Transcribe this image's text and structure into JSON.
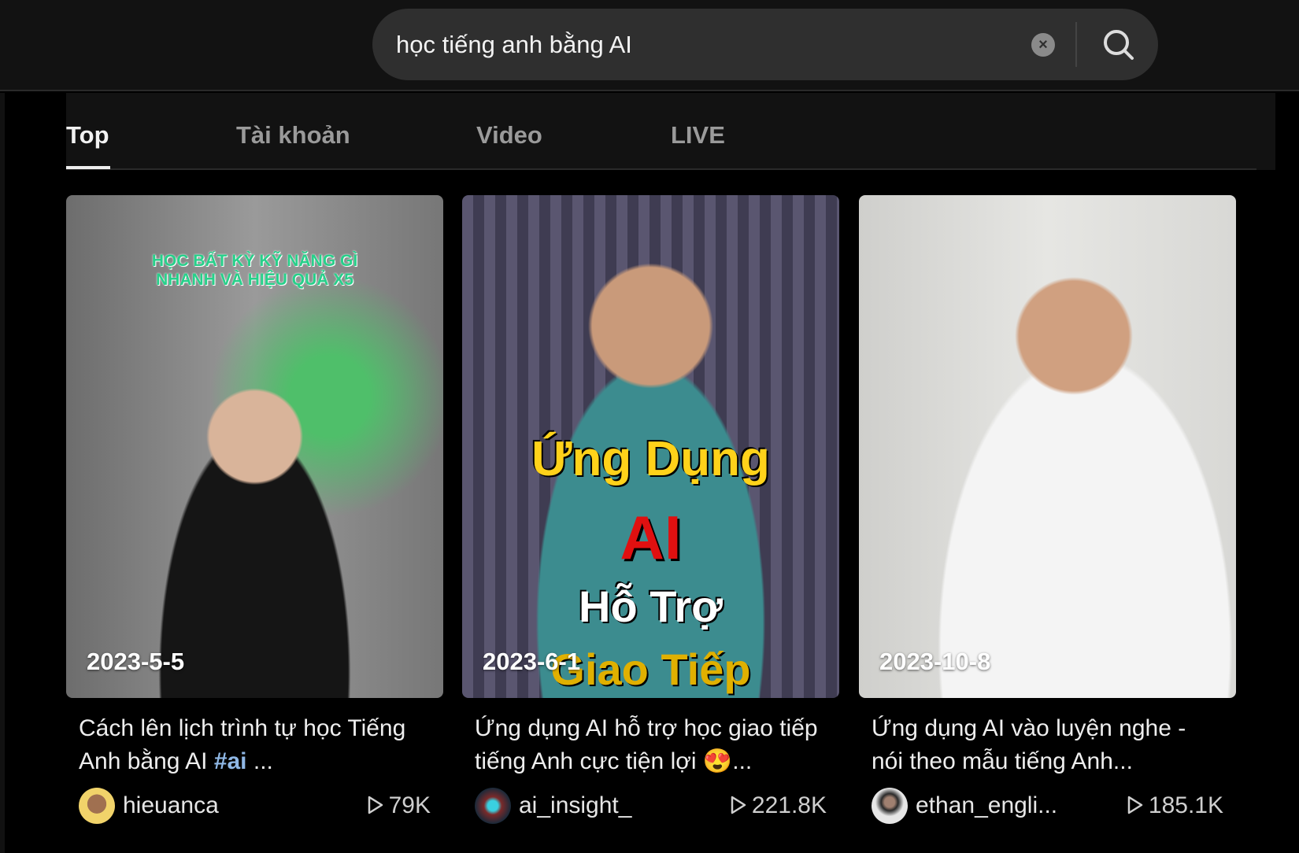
{
  "search": {
    "value": "học tiếng anh bằng AI",
    "clear_icon": "close-circle-icon",
    "search_icon": "search-icon"
  },
  "tabs": [
    {
      "label": "Top",
      "active": true
    },
    {
      "label": "Tài khoản"
    },
    {
      "label": "Video"
    },
    {
      "label": "LIVE"
    }
  ],
  "videos": [
    {
      "date": "2023-5-5",
      "overlay": [
        "HỌC BẤT KỲ KỸ NĂNG GÌ",
        "NHANH VÀ HIỆU QUẢ X5"
      ],
      "title": "Cách lên lịch trình tự học Tiếng Anh bằng AI ",
      "hashtag": "#ai",
      "title_suffix": " ...",
      "author": "hieuanca",
      "views": "79K"
    },
    {
      "date": "2023-6-1",
      "overlay": [
        "Ứng Dụng",
        "AI",
        "Hỗ Trợ",
        "Giao Tiếp"
      ],
      "title": "Ứng dụng AI hỗ trợ học giao tiếp tiếng Anh cực tiện lợi 😍...",
      "author": "ai_insight_",
      "views": "221.8K"
    },
    {
      "date": "2023-10-8",
      "title": "Ứng dụng AI vào luyện nghe - nói theo mẫu tiếng Anh...",
      "author": "ethan_engli...",
      "views": "185.1K"
    }
  ],
  "colors": {
    "background": "#000000",
    "topbar": "#121212",
    "search_bg": "#2f2f2f",
    "hashtag": "#8fb8e6"
  }
}
